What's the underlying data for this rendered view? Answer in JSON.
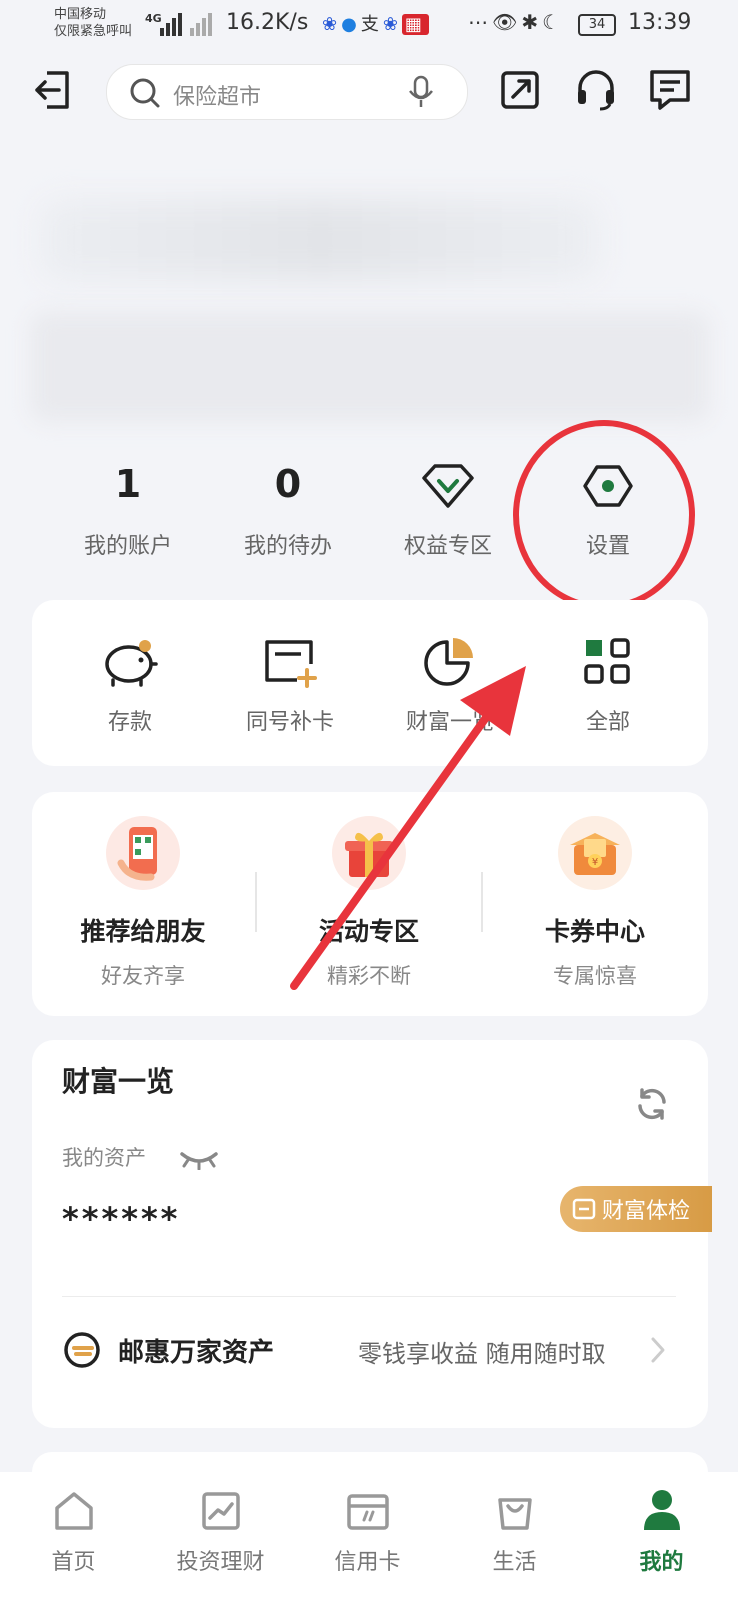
{
  "status_bar": {
    "carrier_line1": "中国移动",
    "carrier_line2": "仅限紧急呼叫",
    "network": "4G",
    "speed": "16.2K/s",
    "battery": "34",
    "time": "13:39"
  },
  "top_bar": {
    "search_placeholder": "保险超市"
  },
  "stats": [
    {
      "value": "1",
      "label": "我的账户"
    },
    {
      "value": "0",
      "label": "我的待办"
    },
    {
      "label": "权益专区"
    },
    {
      "label": "设置"
    }
  ],
  "services": [
    {
      "label": "存款",
      "icon": "piggy-bank-icon"
    },
    {
      "label": "同号补卡",
      "icon": "card-add-icon"
    },
    {
      "label": "财富一览",
      "icon": "pie-chart-icon"
    },
    {
      "label": "全部",
      "icon": "grid-icon"
    }
  ],
  "promos": [
    {
      "title": "推荐给朋友",
      "subtitle": "好友齐享"
    },
    {
      "title": "活动专区",
      "subtitle": "精彩不断"
    },
    {
      "title": "卡券中心",
      "subtitle": "专属惊喜"
    }
  ],
  "wealth": {
    "title": "财富一览",
    "asset_label": "我的资产",
    "asset_value": "******",
    "checkup_label": "财富体检",
    "fund_name": "邮惠万家资产",
    "fund_desc": "零钱享收益 随用随时取"
  },
  "tabs": [
    {
      "label": "首页"
    },
    {
      "label": "投资理财"
    },
    {
      "label": "信用卡"
    },
    {
      "label": "生活"
    },
    {
      "label": "我的"
    }
  ],
  "colors": {
    "brand_green": "#1f7a3f",
    "annotation_red": "#e8343c",
    "checkup_gold": "#d79b45"
  }
}
